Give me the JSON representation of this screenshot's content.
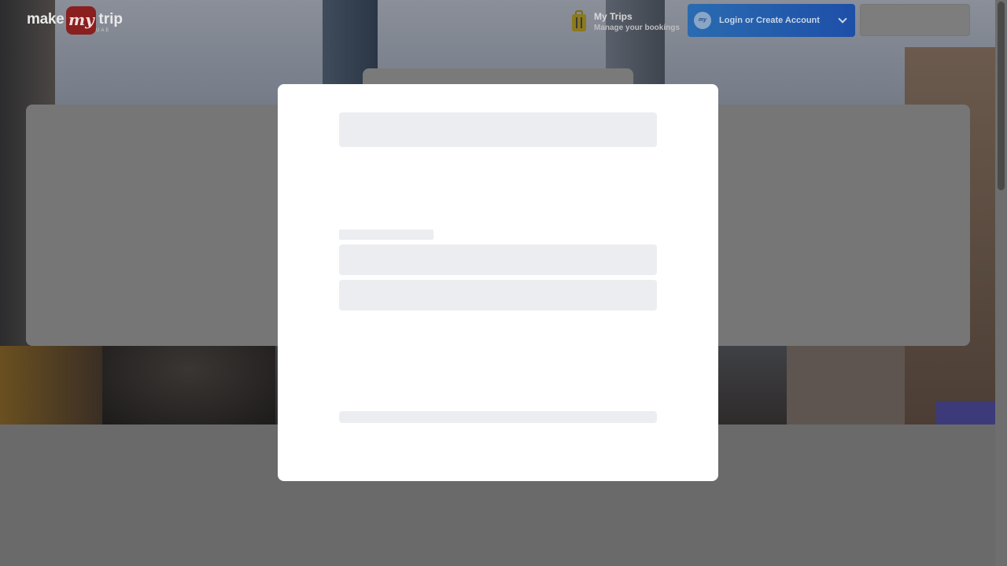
{
  "header": {
    "logo": {
      "word1": "make",
      "word2": "my",
      "word3": "trip",
      "region": "UAE"
    },
    "my_trips": {
      "title": "My Trips",
      "subtitle": "Manage your bookings",
      "icon": "suitcase-icon"
    },
    "login": {
      "label": "Login or Create Account",
      "avatar_text": "my",
      "icon": "chevron-down-icon"
    }
  },
  "modal": {
    "state": "loading",
    "skeleton_blocks": [
      "title",
      "label",
      "field",
      "field",
      "footer"
    ]
  },
  "colors": {
    "login_button": "#1e4fa8",
    "modal_bg": "#ffffff",
    "skeleton": "#ebedf0",
    "overlay": "#6a6a6a"
  }
}
